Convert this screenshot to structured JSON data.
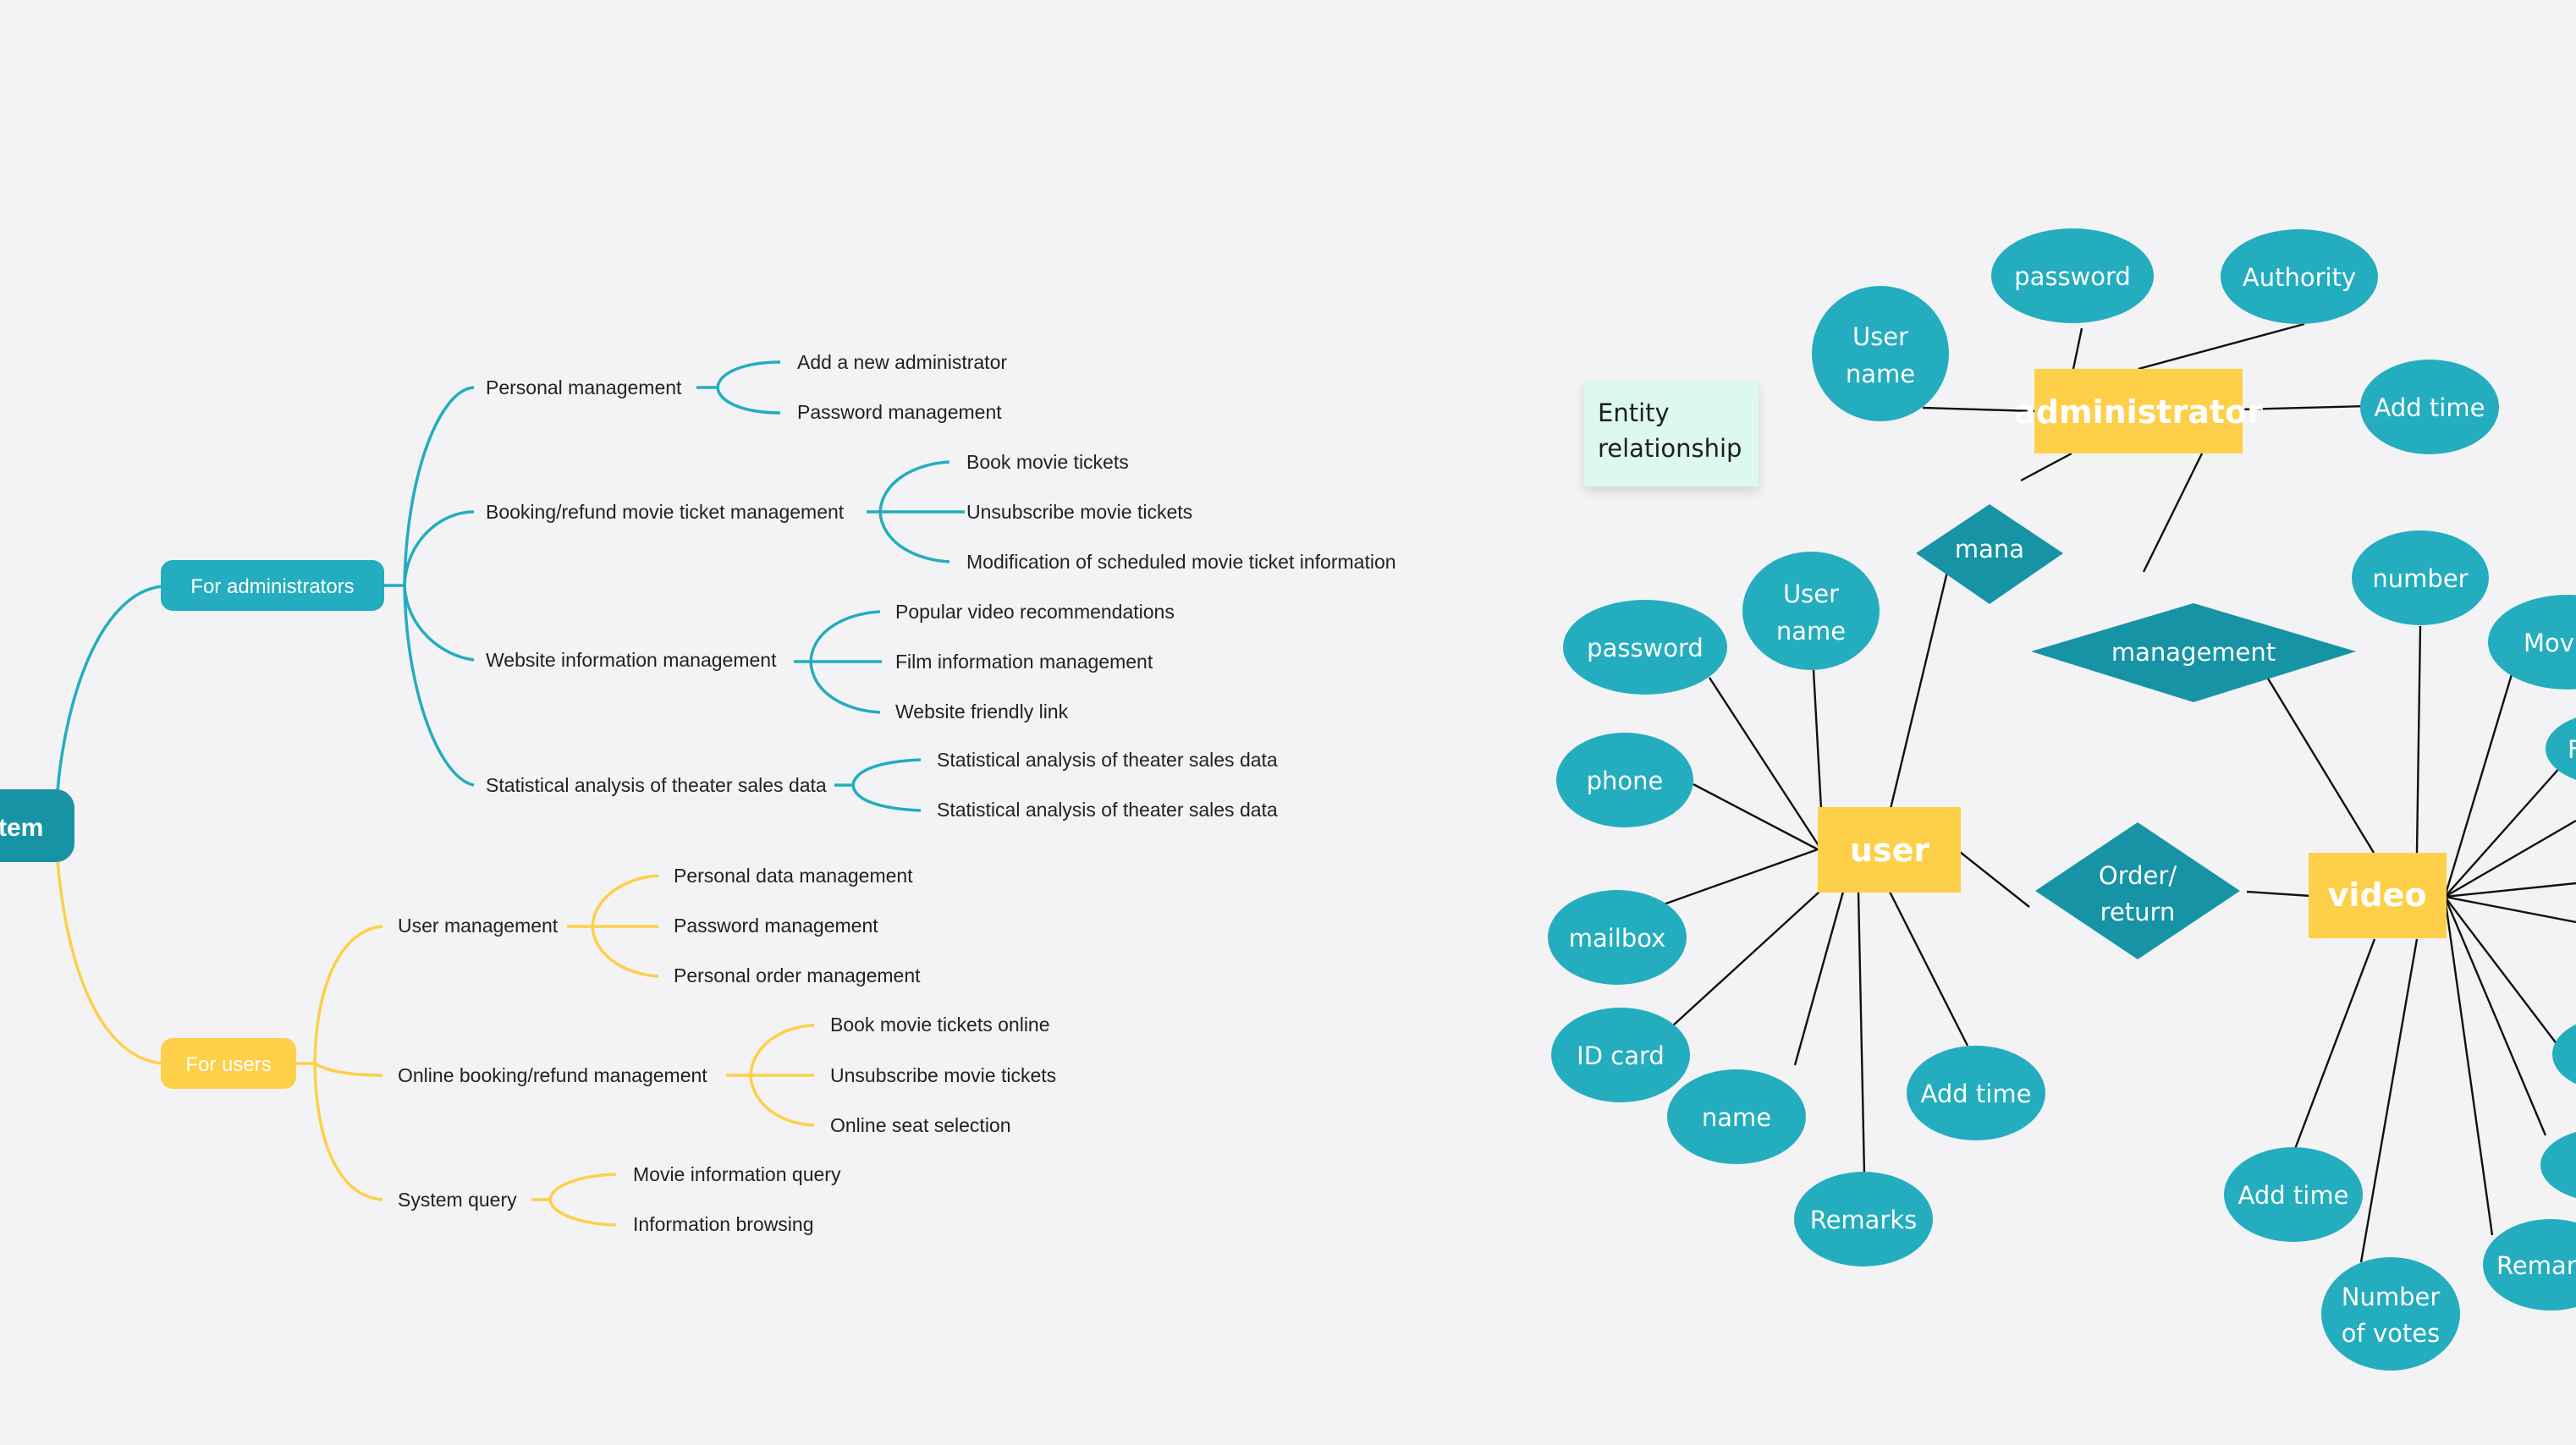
{
  "colors": {
    "background": "#f3f3f5",
    "teal": "#23adbf",
    "teal_dark": "#1793a6",
    "yellow": "#fecf48",
    "note_bg": "#dcf8ef",
    "text_dark": "#222222",
    "line_dark": "#111111"
  },
  "mind_map": {
    "root": {
      "label": "tem",
      "icon": "root-node"
    },
    "branches": [
      {
        "label": "For administrators",
        "color": "teal",
        "children": [
          {
            "label": "Personal management",
            "children": [
              "Add a new administrator",
              "Password management"
            ]
          },
          {
            "label": "Booking/refund movie ticket management",
            "children": [
              "Book movie tickets",
              "Unsubscribe movie tickets",
              "Modification of scheduled movie ticket information"
            ]
          },
          {
            "label": "Website information management",
            "children": [
              "Popular video recommendations",
              "Film information management",
              "Website friendly link"
            ]
          },
          {
            "label": "Statistical analysis of theater sales data",
            "children": [
              "Statistical analysis of theater sales data",
              "Statistical analysis of theater sales data"
            ]
          }
        ]
      },
      {
        "label": "For users",
        "color": "yellow",
        "children": [
          {
            "label": "User management",
            "children": [
              "Personal data management",
              "Password management",
              "Personal order management"
            ]
          },
          {
            "label": "Online booking/refund management",
            "children": [
              "Book movie tickets online",
              "Unsubscribe movie tickets",
              "Online seat selection"
            ]
          },
          {
            "label": "System query",
            "children": [
              "Movie information query",
              "Information browsing"
            ]
          }
        ]
      }
    ]
  },
  "er_diagram": {
    "note": {
      "line1": "Entity",
      "line2": "relationship"
    },
    "entities": {
      "administrator": "administrator",
      "user": "user",
      "video": "video"
    },
    "relationships": {
      "mana": "mana",
      "management": "management",
      "order_return": {
        "line1": "Order/",
        "line2": "return"
      }
    },
    "admin_attributes": {
      "user_name": {
        "line1": "User",
        "line2": "name"
      },
      "password": "password",
      "authority": "Authority",
      "add_time": "Add time"
    },
    "user_attributes": {
      "user_name": {
        "line1": "User",
        "line2": "name"
      },
      "password": "password",
      "phone": "phone",
      "mailbox": "mailbox",
      "id_card": "ID card",
      "name": "name",
      "remarks": "Remarks",
      "add_time": "Add time"
    },
    "video_attributes": {
      "number": "number",
      "movie": "Movi",
      "r1": "F",
      "add_time": "Add time",
      "votes": {
        "line1": "Number",
        "line2": "of votes"
      },
      "remarks": "Remark",
      "r2": "",
      "r3": "",
      "r4": ""
    }
  }
}
